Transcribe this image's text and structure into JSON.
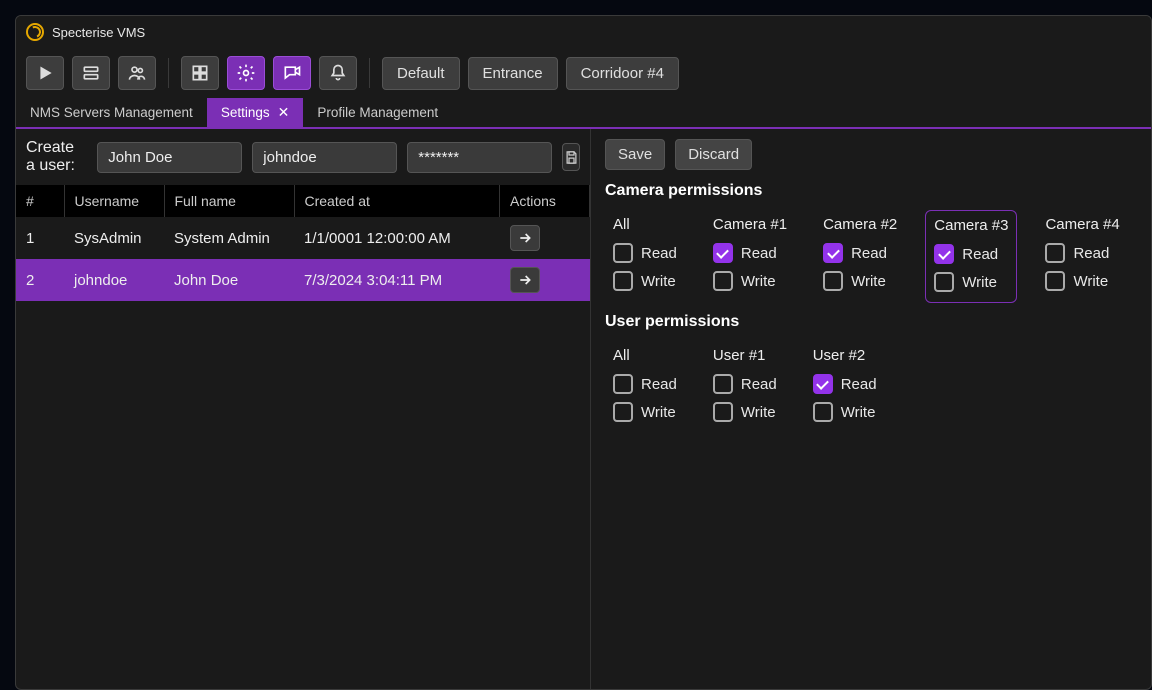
{
  "app": {
    "title": "Specterise VMS"
  },
  "toolbar": {
    "layouts": [
      "Default",
      "Entrance",
      "Corridoor #4"
    ]
  },
  "tabs": [
    {
      "label": "NMS Servers Management",
      "active": false,
      "closable": false
    },
    {
      "label": "Settings",
      "active": true,
      "closable": true
    },
    {
      "label": "Profile Management",
      "active": false,
      "closable": false
    }
  ],
  "createUser": {
    "label": "Create a user:",
    "fullname": "John Doe",
    "username": "johndoe",
    "password": "*******"
  },
  "usersTable": {
    "headers": {
      "num": "#",
      "username": "Username",
      "fullname": "Full name",
      "created": "Created at",
      "actions": "Actions"
    },
    "rows": [
      {
        "num": "1",
        "username": "SysAdmin",
        "fullname": "System Admin",
        "created": "1/1/0001 12:00:00 AM",
        "selected": false
      },
      {
        "num": "2",
        "username": "johndoe",
        "fullname": "John Doe",
        "created": "7/3/2024 3:04:11 PM",
        "selected": true
      }
    ]
  },
  "panel": {
    "save": "Save",
    "discard": "Discard",
    "cameraTitle": "Camera permissions",
    "userTitle": "User permissions",
    "readLabel": "Read",
    "writeLabel": "Write",
    "allLabel": "All",
    "cameras": [
      {
        "name": "All",
        "read": false,
        "write": false,
        "highlight": false
      },
      {
        "name": "Camera #1",
        "read": true,
        "write": false,
        "highlight": false
      },
      {
        "name": "Camera #2",
        "read": true,
        "write": false,
        "highlight": false
      },
      {
        "name": "Camera #3",
        "read": true,
        "write": false,
        "highlight": true
      },
      {
        "name": "Camera #4",
        "read": false,
        "write": false,
        "highlight": false
      }
    ],
    "users": [
      {
        "name": "All",
        "read": false,
        "write": false
      },
      {
        "name": "User #1",
        "read": false,
        "write": false
      },
      {
        "name": "User #2",
        "read": true,
        "write": false
      }
    ]
  }
}
